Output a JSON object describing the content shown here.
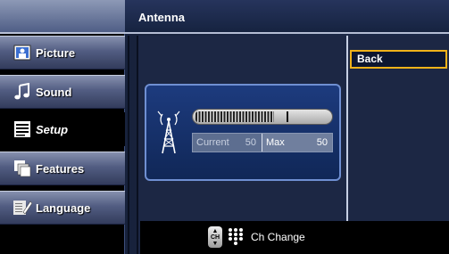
{
  "header": {
    "title": "Antenna"
  },
  "sidebar": {
    "items": [
      {
        "label": "Picture",
        "icon": "picture-icon",
        "active": false
      },
      {
        "label": "Sound",
        "icon": "music-note-icon",
        "active": false
      },
      {
        "label": "Setup",
        "icon": "setup-list-icon",
        "active": true
      },
      {
        "label": "Features",
        "icon": "features-icon",
        "active": false
      },
      {
        "label": "Language",
        "icon": "language-icon",
        "active": false
      }
    ]
  },
  "signal": {
    "current_label": "Current",
    "current_value": "50",
    "max_label": "Max",
    "max_value": "50",
    "meter_level": 0.58
  },
  "right_menu": {
    "back_label": "Back"
  },
  "footer": {
    "ch_icon_text": "CH",
    "hint_text": "Ch Change"
  },
  "colors": {
    "highlight": "#f0b21a",
    "panel": "#1d3b7e",
    "panel_border": "#6f8fd2"
  }
}
